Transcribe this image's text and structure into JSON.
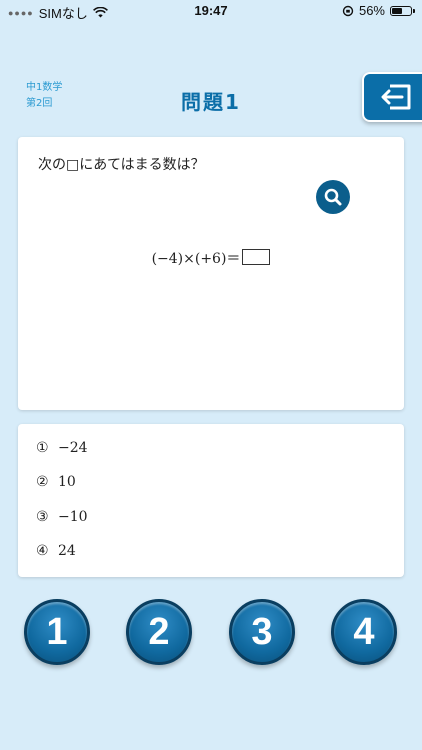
{
  "status_bar": {
    "carrier": "SIMなし",
    "time": "19:47",
    "battery": "56%",
    "battery_level": 0.56
  },
  "header": {
    "subject_line1": "中1数学",
    "subject_line2": "第2回",
    "title": "問題1",
    "exit_icon": "exit-icon"
  },
  "question": {
    "prompt": "次の□にあてはまる数は？",
    "expression": "(−4)×(+6)＝",
    "zoom_icon": "search-icon"
  },
  "choices": [
    {
      "marker": "①",
      "value": "−24"
    },
    {
      "marker": "②",
      "value": "10"
    },
    {
      "marker": "③",
      "value": "−10"
    },
    {
      "marker": "④",
      "value": "24"
    }
  ],
  "answer_buttons": [
    "1",
    "2",
    "3",
    "4"
  ],
  "colors": {
    "background": "#d7ecf9",
    "accent": "#0b6ea8",
    "subject_text": "#2b9ad1"
  }
}
